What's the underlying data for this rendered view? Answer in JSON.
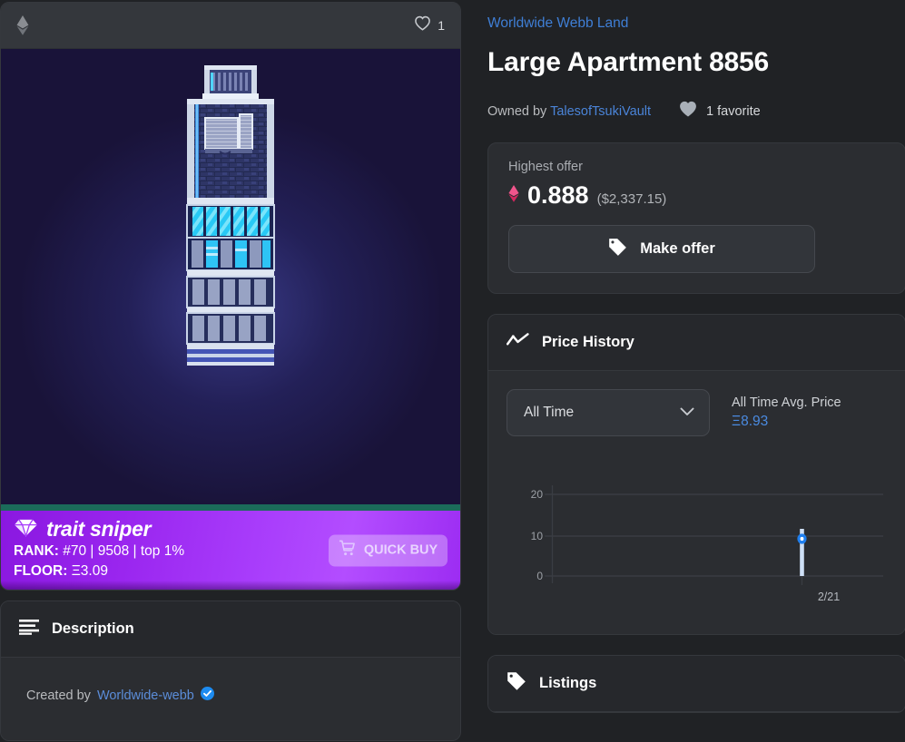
{
  "asset": {
    "topbar": {
      "chain_icon": "ethereum-icon",
      "favorite_icon": "heart-outline-icon",
      "favorite_count": "1"
    },
    "artwork_alt": "Large Apartment pixel art building"
  },
  "trait_sniper": {
    "brand": "trait sniper",
    "brand_icon": "diamond-icon",
    "rank_label": "RANK:",
    "rank_value": "#70 | 9508 | top 1%",
    "floor_label": "FLOOR:",
    "floor_value": "Ξ3.09",
    "quick_buy_label": "QUICK BUY",
    "quick_buy_icon": "cart-icon",
    "gradient_from": "#8a18e0",
    "gradient_to": "#b34dff"
  },
  "description": {
    "header_icon": "list-lines-icon",
    "header_label": "Description",
    "created_prefix": "Created by",
    "creator": "Worldwide-webb",
    "verified_icon": "verified-badge-icon"
  },
  "header": {
    "breadcrumb": "Worldwide Webb Land",
    "title": "Large Apartment 8856",
    "owned_by_prefix": "Owned by",
    "owner": "TalesofTsukiVault",
    "favorite_icon": "heart-filled-icon",
    "favorite_text": "1 favorite"
  },
  "offer": {
    "label": "Highest offer",
    "currency_icon": "ethereum-icon",
    "price": "0.888",
    "usd": "($2,337.15)",
    "button_label": "Make offer",
    "button_icon": "tag-icon"
  },
  "price_history": {
    "header_icon": "trend-line-icon",
    "header_label": "Price History",
    "range_selected": "All Time",
    "range_chevron_icon": "chevron-down-icon",
    "avg_label": "All Time Avg. Price",
    "avg_value": "Ξ8.93"
  },
  "listings": {
    "header_icon": "tag-icon",
    "header_label": "Listings"
  },
  "colors": {
    "page_bg": "#202225",
    "panel_bg": "#2b2d31",
    "link_blue": "#4a84d8",
    "accent_blue": "#4a8ae0",
    "eth_pink": "#e03a73",
    "sniper_purple": "#a83cfb",
    "teal_strip": "#1b6b5a"
  },
  "chart_data": {
    "type": "line",
    "title": "Price History",
    "xlabel": "",
    "ylabel": "",
    "x": [
      "2/21"
    ],
    "categories": [
      "2/21"
    ],
    "values": [
      8.93
    ],
    "series": [
      {
        "name": "Avg. Price",
        "values": [
          8.93
        ]
      }
    ],
    "yticks": [
      0,
      10,
      20
    ],
    "ytick_labels": [
      "0",
      "10",
      "20"
    ],
    "ylim": [
      0,
      20
    ],
    "xtick_labels": [
      "2/21"
    ],
    "grid": true,
    "legend": "none",
    "marker_color": "#1f7fef",
    "bar_color": "#cfe0f7",
    "annotation": "All Time Avg. Price Ξ8.93"
  }
}
